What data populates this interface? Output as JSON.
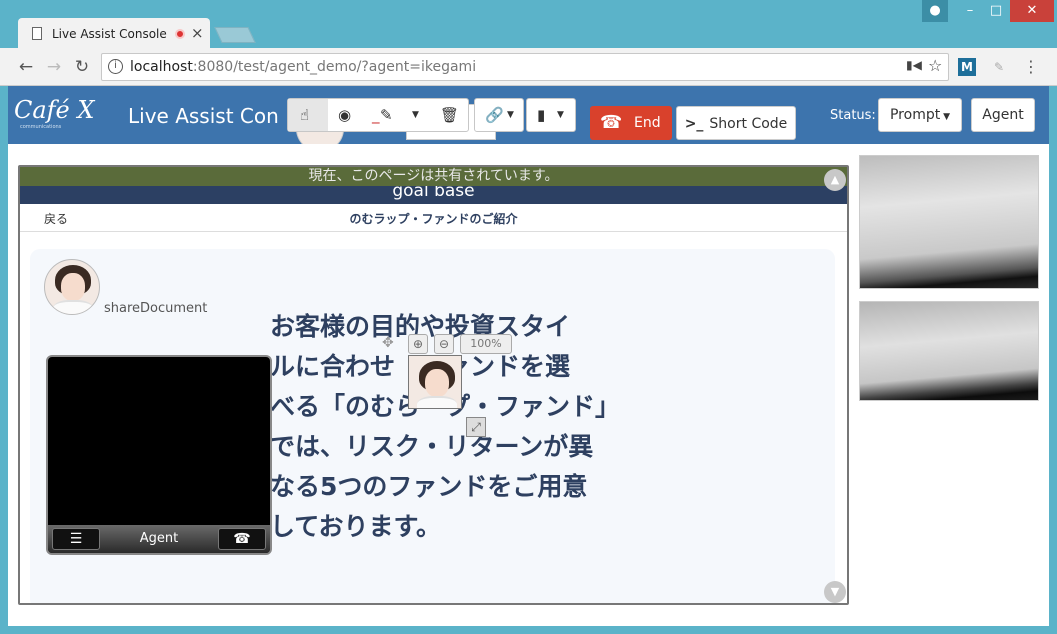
{
  "browser": {
    "tab_title": "Live Assist Console",
    "tab_close": "×",
    "url_host": "localhost",
    "url_rest": ":8080/test/agent_demo/?agent=ikegami"
  },
  "header": {
    "logo": "Café X",
    "logo_sub": "communications",
    "title": "Live Assist Con",
    "end_label": "End",
    "short_code_label": "Short Code",
    "status_label": "Status:",
    "status_value": "Prompt",
    "agent_button": "Agent"
  },
  "viewer": {
    "share_notice": "現在、このページは共有されています。",
    "site_banner": "goal base",
    "back_link": "戻る",
    "page_heading": "のむラップ・ファンドのご紹介",
    "share_document_label": "shareDocument",
    "video_agent_label": "Agent",
    "zoom_level": "100%",
    "body_text_lines": [
      "お客様の目的や投資スタイ",
      "ルに合わせ　ファンドを選",
      "べる「のむら　プ・ファンド」",
      "では、リスク・リターンが異",
      "なる5つのファンドをご用意",
      "しております。"
    ]
  },
  "colors": {
    "header_bg": "#3d74ad",
    "end_button": "#d9412c",
    "share_bar": "#5a6b3a",
    "text_navy": "#2e4060"
  }
}
